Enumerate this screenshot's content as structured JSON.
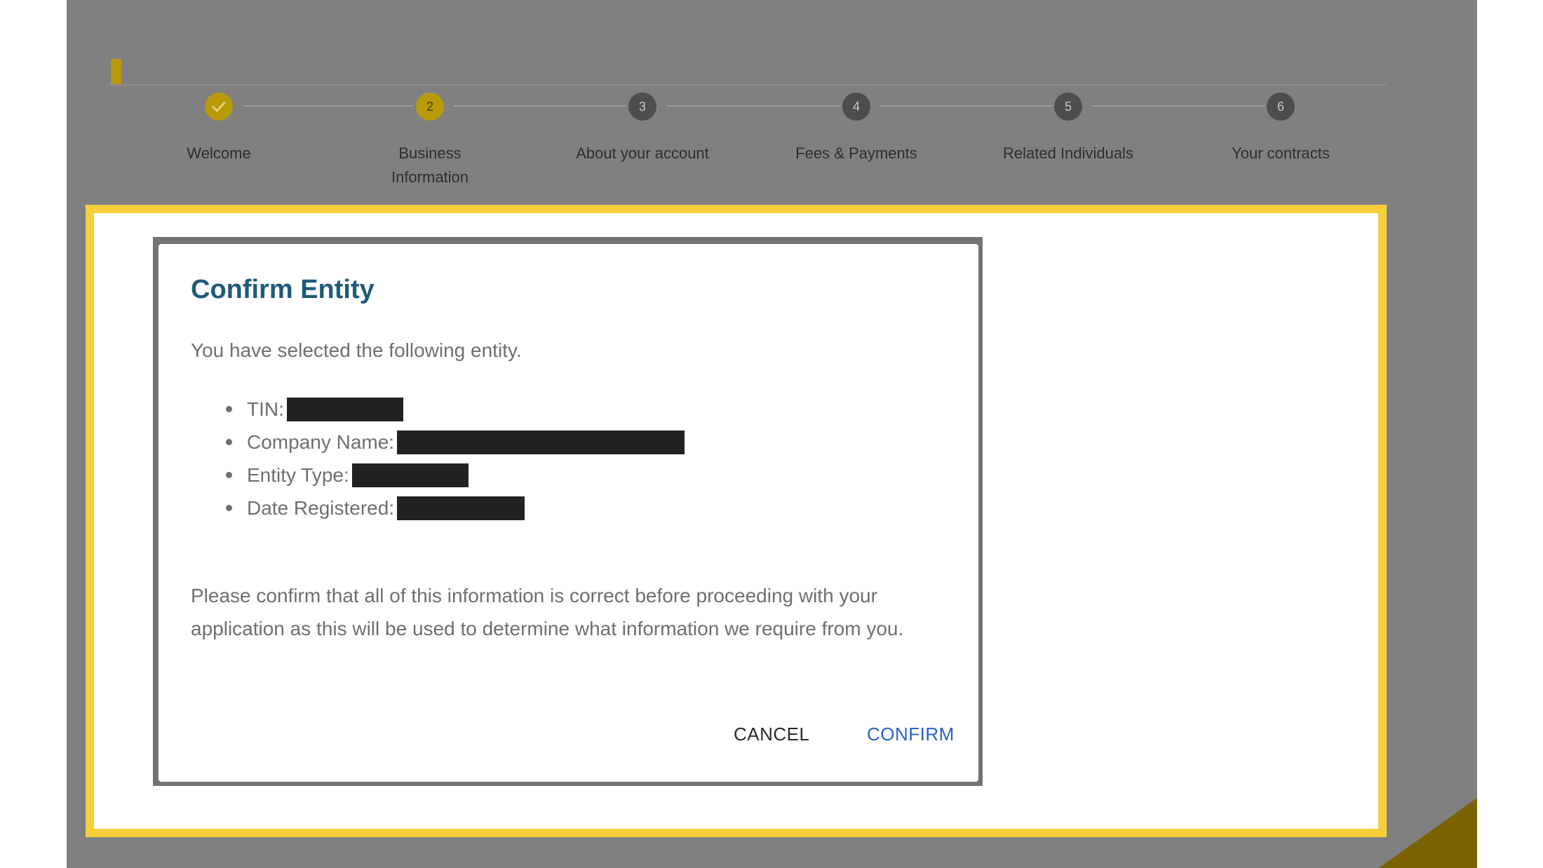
{
  "stepper": {
    "steps": [
      {
        "number": "",
        "label": "Welcome",
        "status": "done",
        "icon": "check-icon"
      },
      {
        "number": "2",
        "label": "Business\nInformation",
        "status": "active"
      },
      {
        "number": "3",
        "label": "About your account",
        "status": "todo"
      },
      {
        "number": "4",
        "label": "Fees & Payments",
        "status": "todo"
      },
      {
        "number": "5",
        "label": "Related Individuals",
        "status": "todo"
      },
      {
        "number": "6",
        "label": "Your contracts",
        "status": "todo"
      }
    ]
  },
  "dialog": {
    "title": "Confirm Entity",
    "intro": "You have selected the following entity.",
    "fields": [
      {
        "label": "TIN:"
      },
      {
        "label": "Company Name:"
      },
      {
        "label": "Entity Type:"
      },
      {
        "label": "Date Registered:"
      }
    ],
    "note": "Please confirm that all of this information is correct before proceeding with your application as this will be used to determine what information we require from you.",
    "cancel_label": "CANCEL",
    "confirm_label": "CONFIRM"
  },
  "colors": {
    "accent_gold": "#b89a0a",
    "highlight_yellow": "#f6cf3a",
    "title_blue": "#1f5a7a",
    "confirm_blue": "#2a62c9",
    "overlay_gray": "#808080"
  }
}
